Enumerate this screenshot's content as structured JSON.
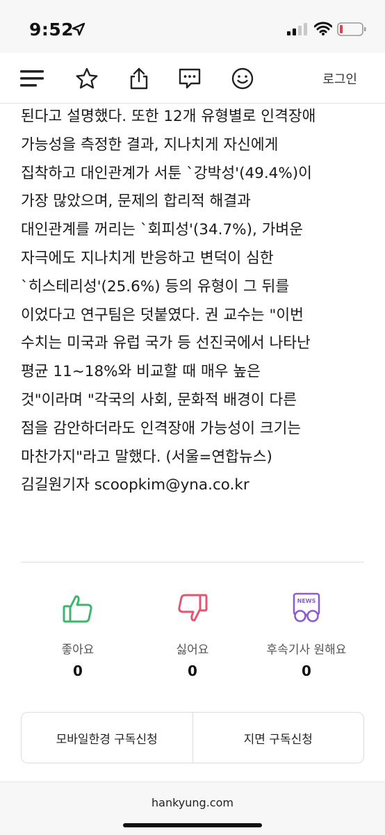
{
  "status": {
    "time": "9:52"
  },
  "toolbar": {
    "login_label": "로그인",
    "icons": [
      "menu-icon",
      "star-icon",
      "share-icon",
      "comment-icon",
      "smiley-icon"
    ]
  },
  "article": {
    "lines": [
      "된다고 설명했다. 또한 12개 유형별로 인격장애",
      "가능성을 측정한 결과, 지나치게 자신에게",
      "집착하고 대인관계가 서툰 `강박성'(49.4%)이",
      "가장 많았으며, 문제의 합리적 해결과",
      "대인관계를 꺼리는 `회피성'(34.7%), 가벼운",
      "자극에도 지나치게 반응하고 변덕이 심한",
      "`히스테리성'(25.6%) 등의 유형이 그 뒤를",
      "이었다고 연구팀은 덧붙였다. 권 교수는 \"이번",
      "수치는 미국과 유럽 국가 등 선진국에서 나타난",
      "평균 11~18%와 비교할 때 매우 높은",
      "것\"이라며 \"각국의 사회, 문화적 배경이 다른",
      "점을 감안하더라도 인격장애 가능성이 크기는",
      "마찬가지\"라고 말했다. (서울=연합뉴스)",
      "김길원기자 scoopkim@yna.co.kr"
    ]
  },
  "reactions": [
    {
      "name": "like",
      "label": "좋아요",
      "count": "0",
      "icon": "thumbs-up-icon",
      "color": "#3fb56b"
    },
    {
      "name": "dislike",
      "label": "싫어요",
      "count": "0",
      "icon": "thumbs-down-icon",
      "color": "#e2566f"
    },
    {
      "name": "follow-up",
      "label": "후속기사 원해요",
      "count": "0",
      "icon": "news-glasses-icon",
      "color": "#8a5cd0",
      "badge": "NEWS"
    }
  ],
  "subscription": {
    "mobile_label": "모바일한경 구독신청",
    "print_label": "지면 구독신청"
  },
  "browser": {
    "url": "hankyung.com"
  }
}
